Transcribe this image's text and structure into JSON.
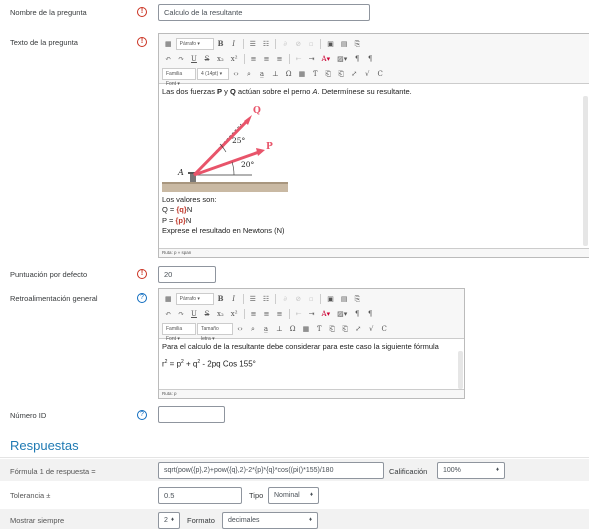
{
  "form": {
    "name_label": "Nombre de la pregunta",
    "name_value": "Calculo de la resultante",
    "text_label": "Texto de la pregunta",
    "default_mark_label": "Puntuación por defecto",
    "default_mark_value": "20",
    "general_feedback_label": "Retroalimentación general",
    "id_number_label": "Número ID",
    "id_number_value": ""
  },
  "icons": {
    "required": "!",
    "help": "?"
  },
  "editor1": {
    "toolbar": {
      "paragraph_select": "Párrafo",
      "font_family_select": "Familia Font",
      "font_size_select": "4 (14pt)"
    },
    "intro": {
      "before_p": "Las dos fuerzas ",
      "p": "P",
      "middle": " y ",
      "q": "Q",
      "after": " actúan sobre el perno ",
      "a": "A",
      "end": ". Determínese su resultante."
    },
    "figure": {
      "label_q": "Q",
      "label_p": "P",
      "label_a": "A",
      "angle_25": "25°",
      "angle_20": "20°"
    },
    "values_title": "Los valores son:",
    "q_prefix": "Q = ",
    "q_var": "{q}",
    "q_suffix": "N",
    "p_prefix": "P = ",
    "p_var": "{p}",
    "p_suffix": "N",
    "instruction": "Exprese el resultado en Newtons (N)",
    "path": "Ruta: p » span"
  },
  "editor2": {
    "toolbar": {
      "paragraph_select": "Párrafo",
      "font_family_select": "Familia Font",
      "font_size_select": "Tamaño letra"
    },
    "line1": "Para el calculo de la resultante debe considerar para este caso la siguiente fórmula",
    "formula_r": "r",
    "formula_eq": " = p",
    "formula_plus": " + q",
    "formula_rest": " - 2pq Cos 155°",
    "sup2": "2",
    "path": "Ruta: p"
  },
  "answers": {
    "heading": "Respuestas",
    "formula_label": "Fórmula 1 de respuesta =",
    "formula_value": "sqrt(pow({p},2)+pow({q},2)-2*{p}*{q}*cos((pi()*155)/180",
    "grade_label": "Calificación",
    "grade_value": "100%",
    "tolerance_label": "Tolerancia ±",
    "tolerance_value": "0.5",
    "tolerance_type_label": "Tipo",
    "tolerance_type_value": "Nominal",
    "show_label": "Mostrar siempre",
    "show_value": "2",
    "format_label": "Formato",
    "format_value": "decimales"
  },
  "colors": {
    "accent": "#1f7ab3",
    "required": "#ca3120",
    "arrow": "#e8546a",
    "variable_red": "#c0392b"
  }
}
